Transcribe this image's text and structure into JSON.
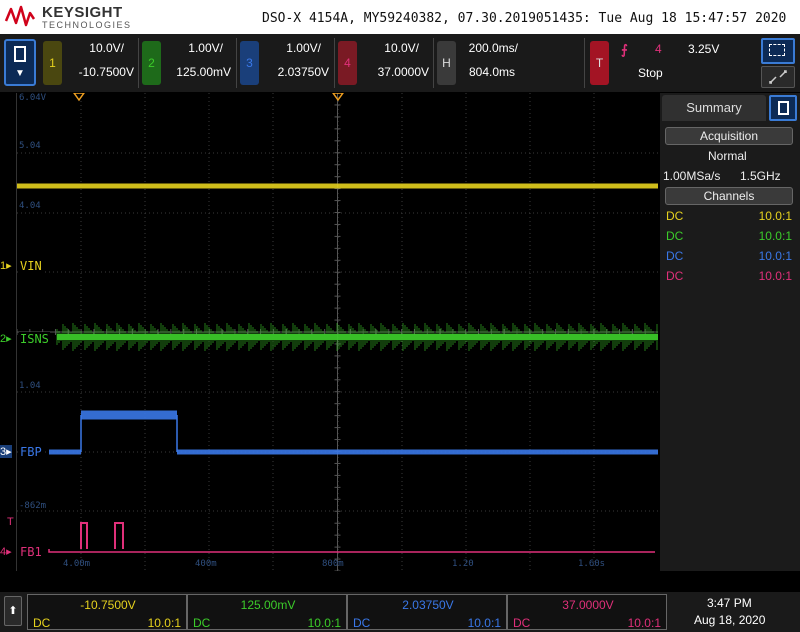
{
  "header": {
    "brand": "KEYSIGHT",
    "brand_sub": "TECHNOLOGIES",
    "instrument_info": "DSO-X 4154A, MY59240382, 07.30.2019051435: Tue Aug 18 15:47:57 2020"
  },
  "channels": [
    {
      "num": "1",
      "scale": "10.0V/",
      "offset": "-10.7500V",
      "color": "#e6d21e",
      "tab_bg": "#4a4710",
      "coupling": "DC",
      "probe": "10.0:1",
      "label": "VIN"
    },
    {
      "num": "2",
      "scale": "1.00V/",
      "offset": "125.00mV",
      "color": "#3ccc2a",
      "tab_bg": "#1e6a1a",
      "coupling": "DC",
      "probe": "10.0:1",
      "label": "ISNS"
    },
    {
      "num": "3",
      "scale": "1.00V/",
      "offset": "2.03750V",
      "color": "#3a78e8",
      "tab_bg": "#1a3f7a",
      "coupling": "DC",
      "probe": "10.0:1",
      "label": "FBP"
    },
    {
      "num": "4",
      "scale": "10.0V/",
      "offset": "37.0000V",
      "color": "#e0307a",
      "tab_bg": "#7a1a24",
      "coupling": "DC",
      "probe": "10.0:1",
      "label": "FB1"
    }
  ],
  "timebase": {
    "tab": "H",
    "scale": "200.0ms/",
    "delay": "804.0ms"
  },
  "trigger": {
    "tab": "T",
    "edge_symbol": "⨍",
    "source": "4",
    "level": "3.25V",
    "state": "Stop"
  },
  "graticule": {
    "y_labels": [
      "6.04V",
      "5.04",
      "4.04",
      "1.04",
      "-862m"
    ],
    "x_labels": [
      "4.00m",
      "400m",
      "800m",
      "1.20",
      "1.60s"
    ]
  },
  "side_panel": {
    "tab_label": "Summary",
    "acquisition_header": "Acquisition",
    "acq_mode": "Normal",
    "sample_rate": "1.00MSa/s",
    "bandwidth": "1.5GHz",
    "channels_header": "Channels"
  },
  "bottom": {
    "clock_time": "3:47 PM",
    "clock_date": "Aug 18, 2020"
  },
  "colors": {
    "ch1": "#e6d21e",
    "ch2": "#3ccc2a",
    "ch3": "#3a78e8",
    "ch4": "#e0307a",
    "grid": "#3a3a3a",
    "accent_blue": "#3a7bd5",
    "trigger_red": "#a31424"
  },
  "icons": {
    "menu": "document-icon",
    "upload": "up-arrow-icon",
    "select": "selection-box-icon",
    "zoom": "zoom-arrows-icon"
  }
}
